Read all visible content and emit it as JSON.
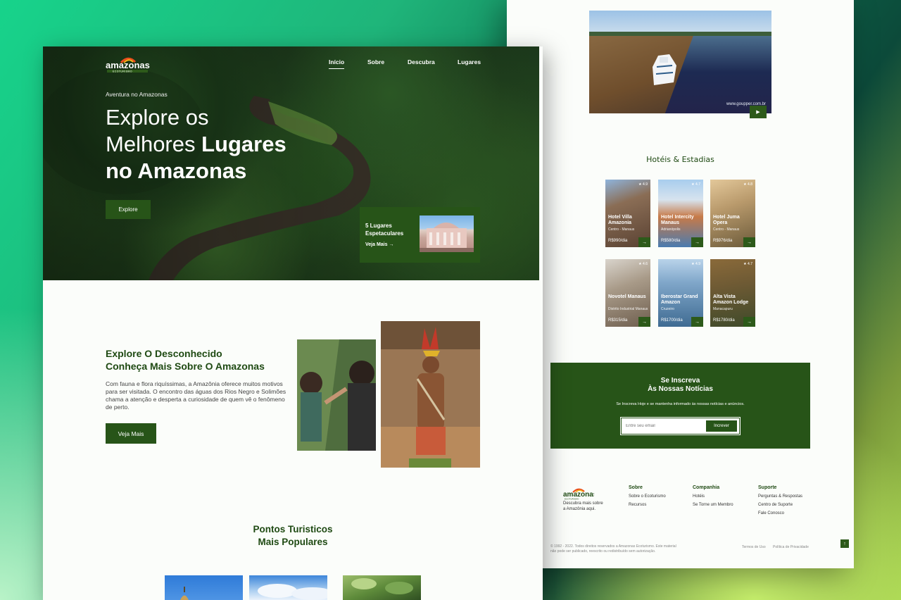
{
  "brand": {
    "logo_text": "amazonas",
    "logo_sub": "ECOTURISMO"
  },
  "hero": {
    "nav": [
      "Início",
      "Sobre",
      "Descubra",
      "Lugares"
    ],
    "kicker": "Aventura no Amazonas",
    "headline_line1": "Explore os",
    "headline_line2_regular": "Melhores ",
    "headline_line2_bold": "Lugares",
    "headline_line3": "no Amazonas",
    "cta": "Explore",
    "card": {
      "title": "5 Lugares Espetaculares",
      "link": "Veja Mais →"
    }
  },
  "about": {
    "title_line1": "Explore O Desconhecido",
    "title_line2": "Conheça Mais Sobre O Amazonas",
    "paragraph": "Com fauna e flora riquíssimas, a Amazônia oferece muitos motivos para ser visitada. O encontro das águas dos Rios Negro e Solimões chama a atenção e desperta a curiosidade de quem vê o fenômeno de perto.",
    "button": "Veja Mais"
  },
  "popular": {
    "title_line1": "Pontos Turisticos",
    "title_line2": "Mais Populares"
  },
  "video": {
    "credit": "www.goupper.com.br",
    "play": "▶"
  },
  "hotels": {
    "title": "Hotéis & Estadias",
    "items": [
      {
        "name": "Hotel Villa Amazonia",
        "location": "Centro - Manaus",
        "price": "R$990/dia",
        "rating": "★ 4.9"
      },
      {
        "name": "Hotel Intercity Manaus",
        "location": "Adrianópolis",
        "price": "R$580/dia",
        "rating": "★ 4.7"
      },
      {
        "name": "Hotel Juma Opera",
        "location": "Centro - Manaus",
        "price": "R$976/dia",
        "rating": "★ 4.8"
      },
      {
        "name": "Novotel Manaus",
        "location": "Distrito Industrial Manaus",
        "price": "R$315/dia",
        "rating": "★ 4.6"
      },
      {
        "name": "Iberostar Grand Amazon",
        "location": "Cruzeiro",
        "price": "R$1700/dia",
        "rating": "★ 4.9"
      },
      {
        "name": "Alta Vista Amazon Lodge",
        "location": "Manacapuru",
        "price": "R$1780/dia",
        "rating": "★ 4.7"
      }
    ]
  },
  "newsletter": {
    "title_line1": "Se Inscreva",
    "title_line2": "Às Nossas Notícias",
    "description": "Se Inscreva Hoje e se mantenha informado às nossas notícias e anúncios.",
    "placeholder": "Entre seu email",
    "button": "Increver"
  },
  "footer": {
    "description": "Descubra mais sobre a Amazônia aqui.",
    "columns": [
      {
        "title": "Sobre",
        "links": [
          "Sobre o Ecoturismo",
          "Recursos"
        ]
      },
      {
        "title": "Companhia",
        "links": [
          "Hotéis",
          "Se Torne um Membro"
        ]
      },
      {
        "title": "Suporte",
        "links": [
          "Perguntas & Respostas",
          "Centro de Suporte",
          "Fale Conosco"
        ]
      }
    ],
    "copyright": "© 1992 - 2022. Todos direitos reservados a Amazonas Ecoturismo. Este material não pode ser publicado, reescrito ou redistribuído sem autorização.",
    "terms": "Termos de Uso",
    "privacy": "Política de Privacidade",
    "to_top": "↑"
  },
  "colors": {
    "brand_green": "#275418",
    "heading_green": "#1f4a13",
    "page_bg": "#fbfdfa"
  }
}
